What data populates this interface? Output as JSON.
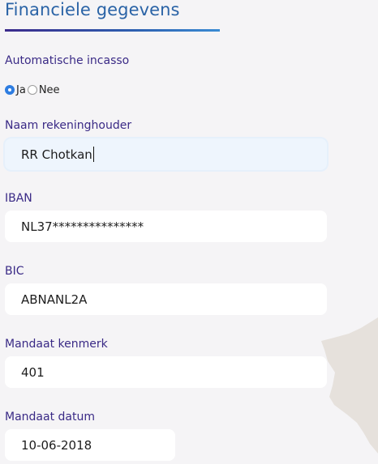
{
  "section": {
    "title": "Financiele gegevens"
  },
  "incasso": {
    "label": "Automatische incasso",
    "options": [
      {
        "label": "Ja",
        "selected": true
      },
      {
        "label": "Nee",
        "selected": false
      }
    ]
  },
  "fields": {
    "account_holder": {
      "label": "Naam rekeninghouder",
      "value": "RR Chotkan"
    },
    "iban": {
      "label": "IBAN",
      "value": "NL37***************"
    },
    "bic": {
      "label": "BIC",
      "value": "ABNANL2A"
    },
    "mandate_reference": {
      "label": "Mandaat kenmerk",
      "value": "401"
    },
    "mandate_date": {
      "label": "Mandaat datum",
      "value": "10-06-2018"
    }
  },
  "colors": {
    "title": "#2a63a6",
    "label": "#3a2a86",
    "radio_accent": "#2e7de1",
    "page_background": "#f5f4f6",
    "field_background": "#ffffff",
    "focused_field_background": "#eef5fd"
  }
}
